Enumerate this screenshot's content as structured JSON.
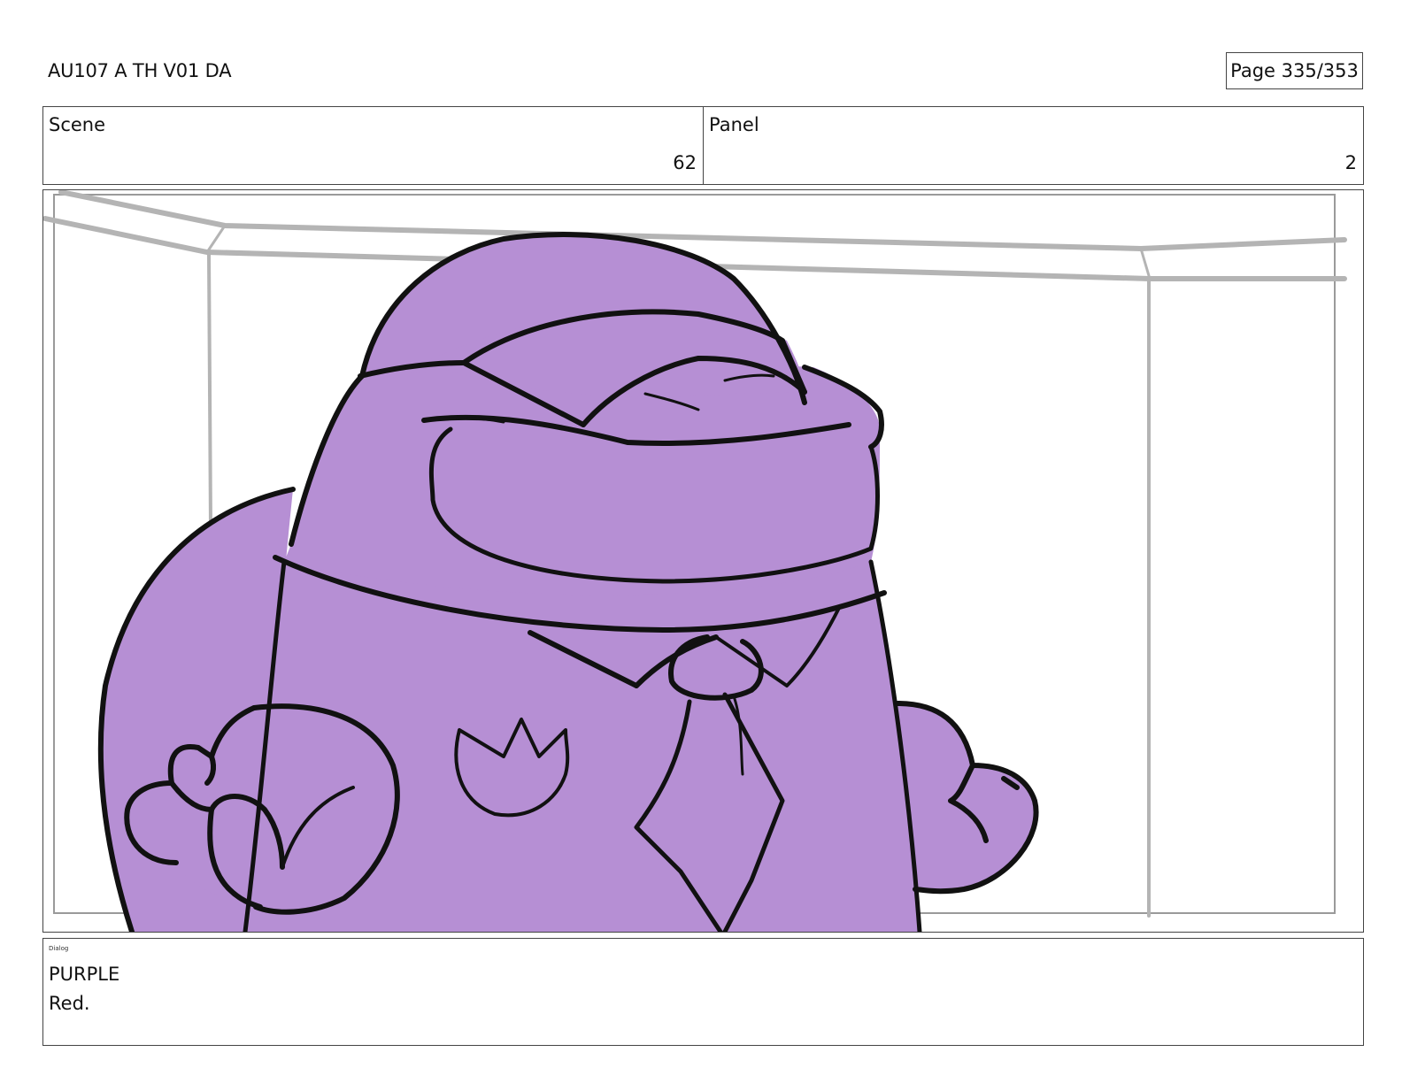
{
  "header": {
    "title": "AU107 A TH V01 DA",
    "page_indicator": "Page 335/353"
  },
  "info": {
    "scene_label": "Scene",
    "scene_value": "62",
    "panel_label": "Panel",
    "panel_value": "2"
  },
  "panel": {
    "character_fill": "#b68fd4",
    "line_color": "#111111",
    "room_line_color": "#b4b4b4"
  },
  "dialog": {
    "label": "Dialog",
    "character": "PURPLE",
    "line": "Red."
  }
}
